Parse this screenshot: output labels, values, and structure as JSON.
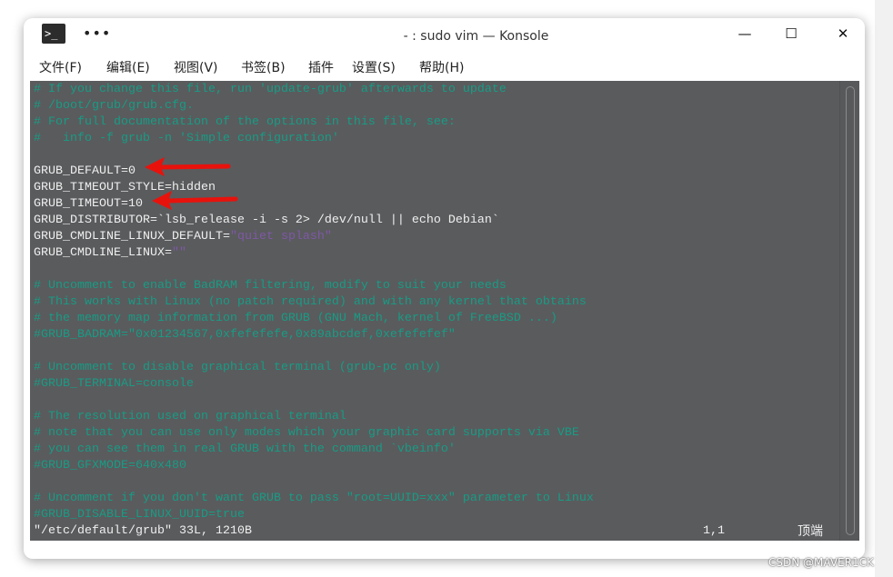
{
  "window": {
    "title": "- : sudo vim — Konsole",
    "more": "•••",
    "icon": "terminal-icon",
    "minimize": "—",
    "maximize": "☐",
    "close": "✕"
  },
  "menu": [
    "文件(F)",
    "编辑(E)",
    "视图(V)",
    "书签(B)",
    "插件",
    "设置(S)",
    "帮助(H)"
  ],
  "editor": {
    "lines": [
      {
        "t": "c",
        "text": "# If you change this file, run 'update-grub' afterwards to update"
      },
      {
        "t": "c",
        "text": "# /boot/grub/grub.cfg."
      },
      {
        "t": "c",
        "text": "# For full documentation of the options in this file, see:"
      },
      {
        "t": "c",
        "text": "#   info -f grub -n 'Simple configuration'"
      },
      {
        "t": "n",
        "text": ""
      },
      {
        "t": "n",
        "text": "GRUB_DEFAULT=0"
      },
      {
        "t": "n",
        "text": "GRUB_TIMEOUT_STYLE=hidden"
      },
      {
        "t": "n",
        "text": "GRUB_TIMEOUT=10"
      },
      {
        "t": "n",
        "text": "GRUB_DISTRIBUTOR=`lsb_release -i -s 2> /dev/null || echo Debian`"
      },
      {
        "t": "n",
        "text": "GRUB_CMDLINE_LINUX_DEFAULT=",
        "str": "\"quiet splash\""
      },
      {
        "t": "n",
        "text": "GRUB_CMDLINE_LINUX=",
        "str": "\"\""
      },
      {
        "t": "n",
        "text": ""
      },
      {
        "t": "c",
        "text": "# Uncomment to enable BadRAM filtering, modify to suit your needs"
      },
      {
        "t": "c",
        "text": "# This works with Linux (no patch required) and with any kernel that obtains"
      },
      {
        "t": "c",
        "text": "# the memory map information from GRUB (GNU Mach, kernel of FreeBSD ...)"
      },
      {
        "t": "c",
        "text": "#GRUB_BADRAM=\"0x01234567,0xfefefefe,0x89abcdef,0xefefefef\""
      },
      {
        "t": "n",
        "text": ""
      },
      {
        "t": "c",
        "text": "# Uncomment to disable graphical terminal (grub-pc only)"
      },
      {
        "t": "c",
        "text": "#GRUB_TERMINAL=console"
      },
      {
        "t": "n",
        "text": ""
      },
      {
        "t": "c",
        "text": "# The resolution used on graphical terminal"
      },
      {
        "t": "c",
        "text": "# note that you can use only modes which your graphic card supports via VBE"
      },
      {
        "t": "c",
        "text": "# you can see them in real GRUB with the command `vbeinfo'"
      },
      {
        "t": "c",
        "text": "#GRUB_GFXMODE=640x480"
      },
      {
        "t": "n",
        "text": ""
      },
      {
        "t": "c",
        "text": "# Uncomment if you don't want GRUB to pass \"root=UUID=xxx\" parameter to Linux"
      },
      {
        "t": "c",
        "text": "#GRUB_DISABLE_LINUX_UUID=true"
      }
    ],
    "status": {
      "file": "\"/etc/default/grub\" 33L, 1210B",
      "cursor": "1,1",
      "position": "顶端"
    },
    "comment_color": "#179c85",
    "string_color": "#7e58a6",
    "annotation_arrow_color": "#e8120c"
  },
  "watermark": "CSDN @MAVER1CK"
}
